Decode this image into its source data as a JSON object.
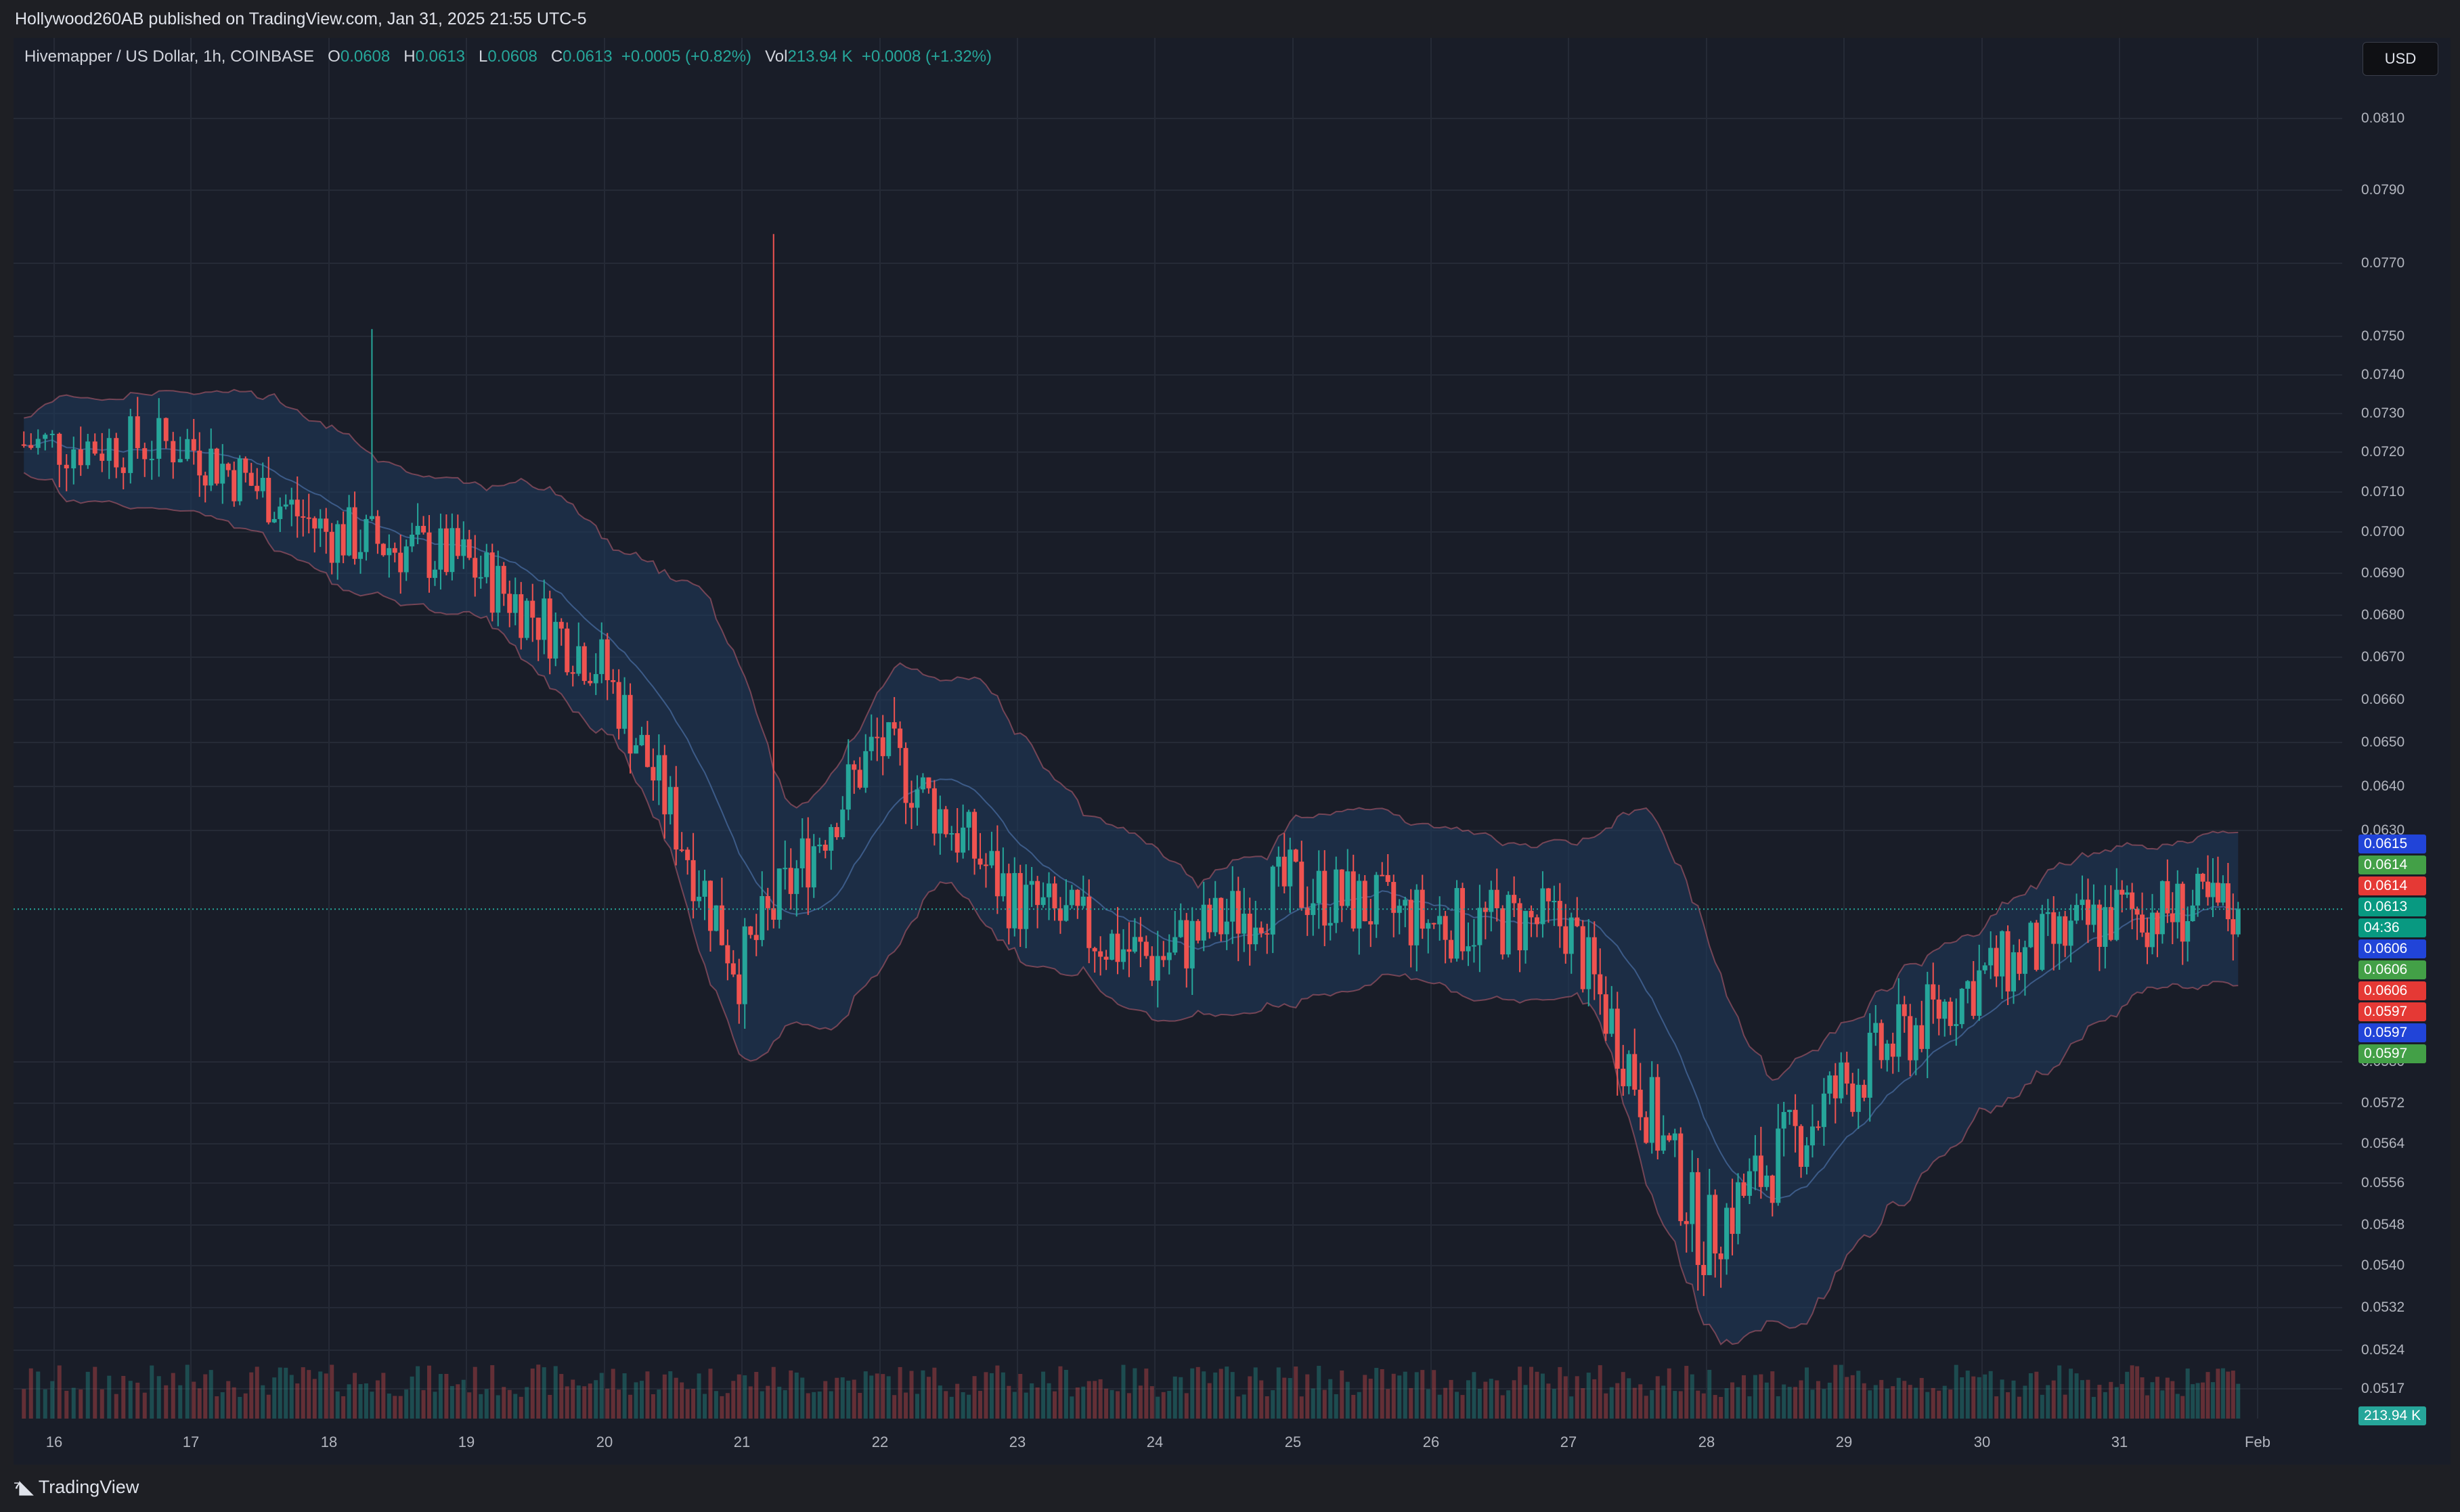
{
  "header": {
    "published": "Hollywood260AB published on TradingView.com, Jan 31, 2025 21:55 UTC-5"
  },
  "legend": {
    "symbol": "Hivemapper / US Dollar, 1h, COINBASE",
    "o_label": "O",
    "o_value": "0.0608",
    "h_label": "H",
    "h_value": "0.0613",
    "l_label": "L",
    "l_value": "0.0608",
    "c_label": "C",
    "c_value": "0.0613",
    "change": "+0.0005 (+0.82%)",
    "vol_label": "Vol",
    "vol_value": "213.94 K",
    "vol_change": "+0.0008 (+1.32%)"
  },
  "currency": "USD",
  "price_axis": [
    {
      "price": 0.081,
      "label": "0.0810"
    },
    {
      "price": 0.079,
      "label": "0.0790"
    },
    {
      "price": 0.077,
      "label": "0.0770"
    },
    {
      "price": 0.075,
      "label": "0.0750"
    },
    {
      "price": 0.074,
      "label": "0.0740"
    },
    {
      "price": 0.073,
      "label": "0.0730"
    },
    {
      "price": 0.072,
      "label": "0.0720"
    },
    {
      "price": 0.071,
      "label": "0.0710"
    },
    {
      "price": 0.07,
      "label": "0.0700"
    },
    {
      "price": 0.069,
      "label": "0.0690"
    },
    {
      "price": 0.068,
      "label": "0.0680"
    },
    {
      "price": 0.067,
      "label": "0.0670"
    },
    {
      "price": 0.066,
      "label": "0.0660"
    },
    {
      "price": 0.065,
      "label": "0.0650"
    },
    {
      "price": 0.064,
      "label": "0.0640"
    },
    {
      "price": 0.063,
      "label": "0.0630"
    },
    {
      "price": 0.058,
      "label": "0.0580"
    },
    {
      "price": 0.0572,
      "label": "0.0572"
    },
    {
      "price": 0.0564,
      "label": "0.0564"
    },
    {
      "price": 0.0556,
      "label": "0.0556"
    },
    {
      "price": 0.0548,
      "label": "0.0548"
    },
    {
      "price": 0.054,
      "label": "0.0540"
    },
    {
      "price": 0.0532,
      "label": "0.0532"
    },
    {
      "price": 0.0524,
      "label": "0.0524"
    },
    {
      "price": 0.0517,
      "label": "0.0517"
    }
  ],
  "price_tags": [
    {
      "label": "0.0615",
      "price": 0.0615,
      "color": "#2144d8"
    },
    {
      "label": "0.0614",
      "price": 0.0614,
      "color": "#43a047"
    },
    {
      "label": "0.0614",
      "price": 0.06135,
      "color": "#e53935"
    },
    {
      "label": "0.0613",
      "price": 0.0613,
      "color": "#089981"
    },
    {
      "label": "04:36",
      "price": 0.06125,
      "color": "#089981"
    },
    {
      "label": "0.0606",
      "price": 0.0606,
      "color": "#2144d8"
    },
    {
      "label": "0.0606",
      "price": 0.06055,
      "color": "#43a047"
    },
    {
      "label": "0.0606",
      "price": 0.0605,
      "color": "#e53935"
    },
    {
      "label": "0.0597",
      "price": 0.05975,
      "color": "#e53935"
    },
    {
      "label": "0.0597",
      "price": 0.0597,
      "color": "#2144d8"
    },
    {
      "label": "0.0597",
      "price": 0.05965,
      "color": "#43a047"
    }
  ],
  "volume_tag": {
    "label": "213.94 K",
    "color": "#26a69a"
  },
  "time_axis": [
    "16",
    "17",
    "18",
    "19",
    "20",
    "21",
    "22",
    "23",
    "24",
    "25",
    "26",
    "27",
    "28",
    "29",
    "30",
    "31",
    "Feb"
  ],
  "brand": "TradingView",
  "colors": {
    "up": "#26a69a",
    "down": "#ef5350",
    "band_fill": "#1f3a5c",
    "band_line": "#4a6fa5",
    "background": "#191d28"
  },
  "chart_data": {
    "type": "candlestick",
    "symbol": "Hivemapper / US Dollar",
    "interval": "1h",
    "exchange": "COINBASE",
    "x_ticks": [
      "16",
      "17",
      "18",
      "19",
      "20",
      "21",
      "22",
      "23",
      "24",
      "25",
      "26",
      "27",
      "28",
      "29",
      "30",
      "31",
      "Feb"
    ],
    "ylim": [
      0.0517,
      0.081
    ],
    "last_close": 0.0613,
    "daily_closes": [
      {
        "day": "16",
        "close": 0.0722
      },
      {
        "day": "17",
        "close": 0.07
      },
      {
        "day": "18",
        "close": 0.0693
      },
      {
        "day": "19",
        "close": 0.0668
      },
      {
        "day": "20",
        "close": 0.06
      },
      {
        "day": "21",
        "close": 0.065
      },
      {
        "day": "22",
        "close": 0.0615
      },
      {
        "day": "23",
        "close": 0.0602
      },
      {
        "day": "24",
        "close": 0.0618
      },
      {
        "day": "25",
        "close": 0.061
      },
      {
        "day": "26",
        "close": 0.061
      },
      {
        "day": "27",
        "close": 0.0545
      },
      {
        "day": "28",
        "close": 0.0575
      },
      {
        "day": "29",
        "close": 0.0598
      },
      {
        "day": "30",
        "close": 0.0612
      },
      {
        "day": "31",
        "close": 0.0613
      }
    ]
  }
}
